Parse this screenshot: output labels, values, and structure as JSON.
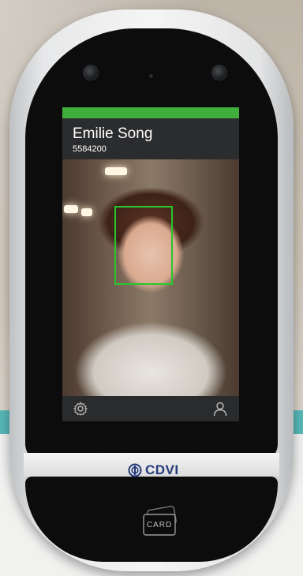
{
  "screen": {
    "user_name": "Emilie Song",
    "user_id": "5584200",
    "status_color": "#3fae3c",
    "face_box_color": "#29c62d"
  },
  "bottom_bar": {
    "left_icon": "gear-icon",
    "right_icon": "user-icon"
  },
  "device": {
    "brand": "CDVI",
    "card_label": "CARD"
  }
}
